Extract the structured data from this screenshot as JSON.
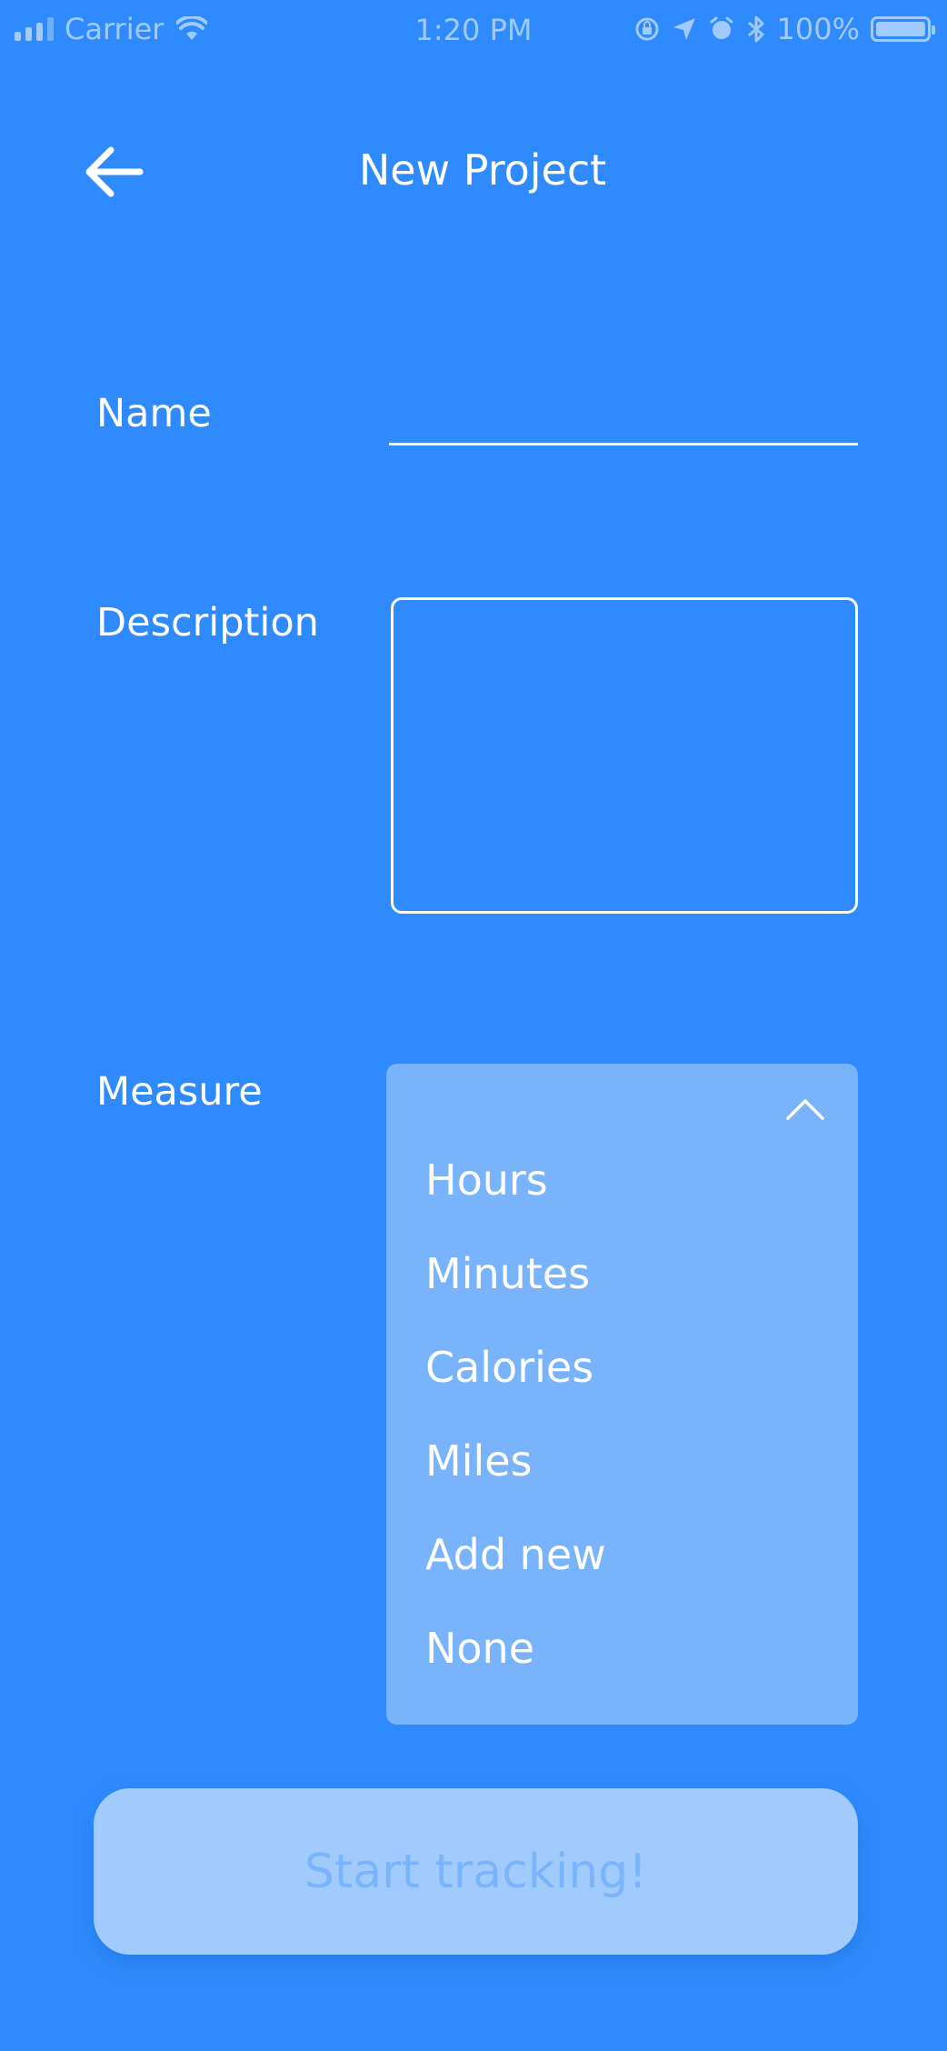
{
  "status_bar": {
    "carrier": "Carrier",
    "time": "1:20 PM",
    "battery": "100%"
  },
  "header": {
    "title": "New Project",
    "back_icon": "arrow-left-icon"
  },
  "form": {
    "name_label": "Name",
    "name_value": "",
    "description_label": "Description",
    "description_value": "",
    "measure_label": "Measure",
    "measure_options": [
      "Hours",
      "Minutes",
      "Calories",
      "Miles",
      "Add new",
      "None"
    ],
    "measure_toggle_icon": "chevron-up-icon"
  },
  "actions": {
    "start_label": "Start tracking!"
  },
  "colors": {
    "background": "#2f8bfd",
    "dropdown_bg": "#78b3fc",
    "button_bg": "#a2cbfd",
    "button_text": "#7ab4fc",
    "text": "#ffffff"
  }
}
